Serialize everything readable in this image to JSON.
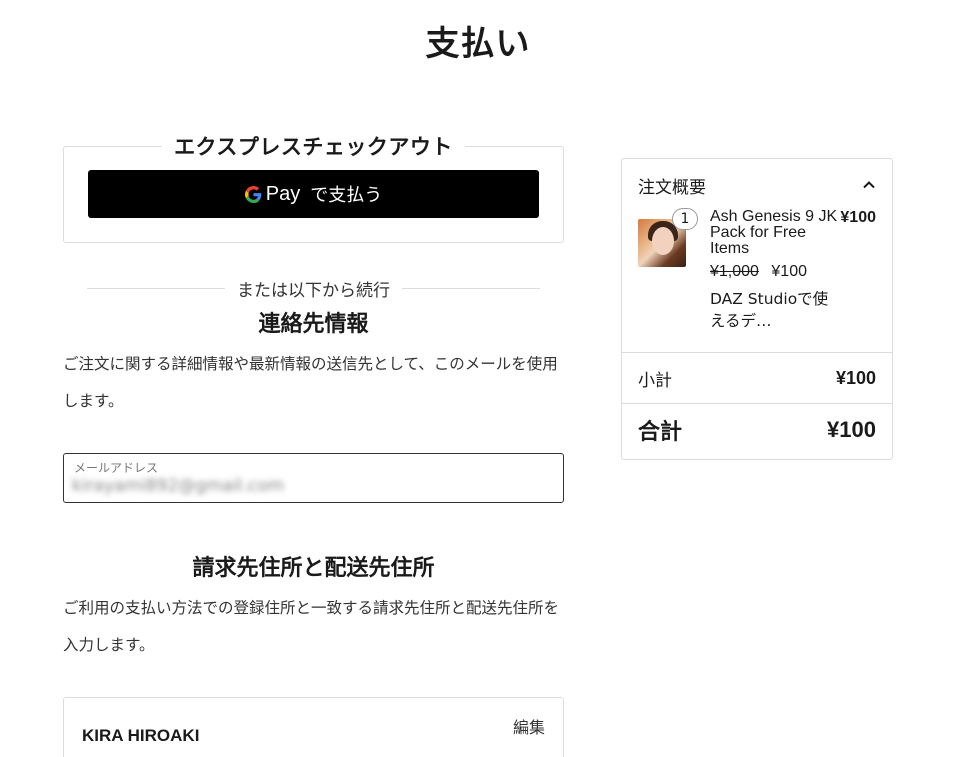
{
  "page": {
    "title": "支払い"
  },
  "express_checkout": {
    "legend": "エクスプレスチェックアウト",
    "gpay_pay_text": "Pay",
    "gpay_label": "で支払う"
  },
  "divider": {
    "text": "または以下から続行"
  },
  "contact": {
    "heading": "連絡先情報",
    "description": "ご注文に関する詳細情報や最新情報の送信先として、このメールを使用します。",
    "email_label": "メールアドレス",
    "email_value": "kirayami892@gmail.com"
  },
  "address": {
    "heading": "請求先住所と配送先住所",
    "description": "ご利用の支払い方法での登録住所と一致する請求先住所と配送先住所を入力します。",
    "name": "KIRA HIROAKI",
    "edit_label": "編集"
  },
  "summary": {
    "title": "注文概要",
    "item": {
      "quantity": "1",
      "name": "Ash Genesis 9 JK Pack for Free Items",
      "price": "¥100",
      "original_price": "¥1,000",
      "sale_price": "¥100",
      "description": "DAZ Studioで使えるデ…"
    },
    "subtotal_label": "小計",
    "subtotal_value": "¥100",
    "total_label": "合計",
    "total_value": "¥100"
  },
  "colors": {
    "button_bg": "#000000",
    "border": "#dcdcdc"
  },
  "icons": [
    "google-g-icon",
    "chevron-up-icon"
  ]
}
